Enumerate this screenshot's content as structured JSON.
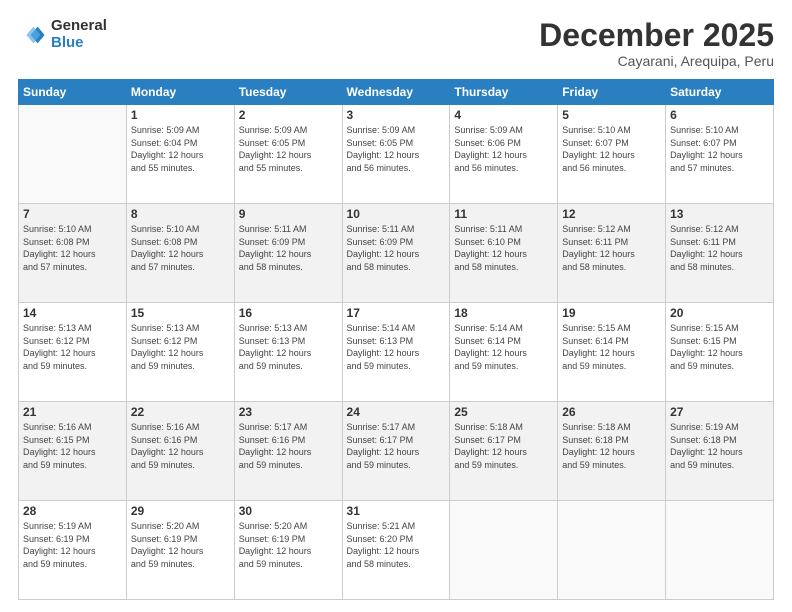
{
  "logo": {
    "general": "General",
    "blue": "Blue"
  },
  "header": {
    "month": "December 2025",
    "location": "Cayarani, Arequipa, Peru"
  },
  "weekdays": [
    "Sunday",
    "Monday",
    "Tuesday",
    "Wednesday",
    "Thursday",
    "Friday",
    "Saturday"
  ],
  "weeks": [
    [
      {
        "day": "",
        "info": ""
      },
      {
        "day": "1",
        "info": "Sunrise: 5:09 AM\nSunset: 6:04 PM\nDaylight: 12 hours\nand 55 minutes."
      },
      {
        "day": "2",
        "info": "Sunrise: 5:09 AM\nSunset: 6:05 PM\nDaylight: 12 hours\nand 55 minutes."
      },
      {
        "day": "3",
        "info": "Sunrise: 5:09 AM\nSunset: 6:05 PM\nDaylight: 12 hours\nand 56 minutes."
      },
      {
        "day": "4",
        "info": "Sunrise: 5:09 AM\nSunset: 6:06 PM\nDaylight: 12 hours\nand 56 minutes."
      },
      {
        "day": "5",
        "info": "Sunrise: 5:10 AM\nSunset: 6:07 PM\nDaylight: 12 hours\nand 56 minutes."
      },
      {
        "day": "6",
        "info": "Sunrise: 5:10 AM\nSunset: 6:07 PM\nDaylight: 12 hours\nand 57 minutes."
      }
    ],
    [
      {
        "day": "7",
        "info": ""
      },
      {
        "day": "8",
        "info": "Sunrise: 5:10 AM\nSunset: 6:08 PM\nDaylight: 12 hours\nand 57 minutes."
      },
      {
        "day": "9",
        "info": "Sunrise: 5:11 AM\nSunset: 6:09 PM\nDaylight: 12 hours\nand 58 minutes."
      },
      {
        "day": "10",
        "info": "Sunrise: 5:11 AM\nSunset: 6:09 PM\nDaylight: 12 hours\nand 58 minutes."
      },
      {
        "day": "11",
        "info": "Sunrise: 5:11 AM\nSunset: 6:10 PM\nDaylight: 12 hours\nand 58 minutes."
      },
      {
        "day": "12",
        "info": "Sunrise: 5:12 AM\nSunset: 6:11 PM\nDaylight: 12 hours\nand 58 minutes."
      },
      {
        "day": "13",
        "info": "Sunrise: 5:12 AM\nSunset: 6:11 PM\nDaylight: 12 hours\nand 58 minutes."
      }
    ],
    [
      {
        "day": "14",
        "info": ""
      },
      {
        "day": "15",
        "info": "Sunrise: 5:13 AM\nSunset: 6:12 PM\nDaylight: 12 hours\nand 59 minutes."
      },
      {
        "day": "16",
        "info": "Sunrise: 5:13 AM\nSunset: 6:13 PM\nDaylight: 12 hours\nand 59 minutes."
      },
      {
        "day": "17",
        "info": "Sunrise: 5:14 AM\nSunset: 6:13 PM\nDaylight: 12 hours\nand 59 minutes."
      },
      {
        "day": "18",
        "info": "Sunrise: 5:14 AM\nSunset: 6:14 PM\nDaylight: 12 hours\nand 59 minutes."
      },
      {
        "day": "19",
        "info": "Sunrise: 5:15 AM\nSunset: 6:14 PM\nDaylight: 12 hours\nand 59 minutes."
      },
      {
        "day": "20",
        "info": "Sunrise: 5:15 AM\nSunset: 6:15 PM\nDaylight: 12 hours\nand 59 minutes."
      }
    ],
    [
      {
        "day": "21",
        "info": ""
      },
      {
        "day": "22",
        "info": "Sunrise: 5:16 AM\nSunset: 6:16 PM\nDaylight: 12 hours\nand 59 minutes."
      },
      {
        "day": "23",
        "info": "Sunrise: 5:17 AM\nSunset: 6:16 PM\nDaylight: 12 hours\nand 59 minutes."
      },
      {
        "day": "24",
        "info": "Sunrise: 5:17 AM\nSunset: 6:17 PM\nDaylight: 12 hours\nand 59 minutes."
      },
      {
        "day": "25",
        "info": "Sunrise: 5:18 AM\nSunset: 6:17 PM\nDaylight: 12 hours\nand 59 minutes."
      },
      {
        "day": "26",
        "info": "Sunrise: 5:18 AM\nSunset: 6:18 PM\nDaylight: 12 hours\nand 59 minutes."
      },
      {
        "day": "27",
        "info": "Sunrise: 5:19 AM\nSunset: 6:18 PM\nDaylight: 12 hours\nand 59 minutes."
      }
    ],
    [
      {
        "day": "28",
        "info": "Sunrise: 5:19 AM\nSunset: 6:19 PM\nDaylight: 12 hours\nand 59 minutes."
      },
      {
        "day": "29",
        "info": "Sunrise: 5:20 AM\nSunset: 6:19 PM\nDaylight: 12 hours\nand 59 minutes."
      },
      {
        "day": "30",
        "info": "Sunrise: 5:20 AM\nSunset: 6:19 PM\nDaylight: 12 hours\nand 59 minutes."
      },
      {
        "day": "31",
        "info": "Sunrise: 5:21 AM\nSunset: 6:20 PM\nDaylight: 12 hours\nand 58 minutes."
      },
      {
        "day": "",
        "info": ""
      },
      {
        "day": "",
        "info": ""
      },
      {
        "day": "",
        "info": ""
      }
    ]
  ],
  "week7info": {
    "7": "Sunrise: 5:10 AM\nSunset: 6:08 PM\nDaylight: 12 hours\nand 57 minutes.",
    "14": "Sunrise: 5:13 AM\nSunset: 6:12 PM\nDaylight: 12 hours\nand 59 minutes.",
    "21": "Sunrise: 5:16 AM\nSunset: 6:15 PM\nDaylight: 12 hours\nand 59 minutes."
  }
}
